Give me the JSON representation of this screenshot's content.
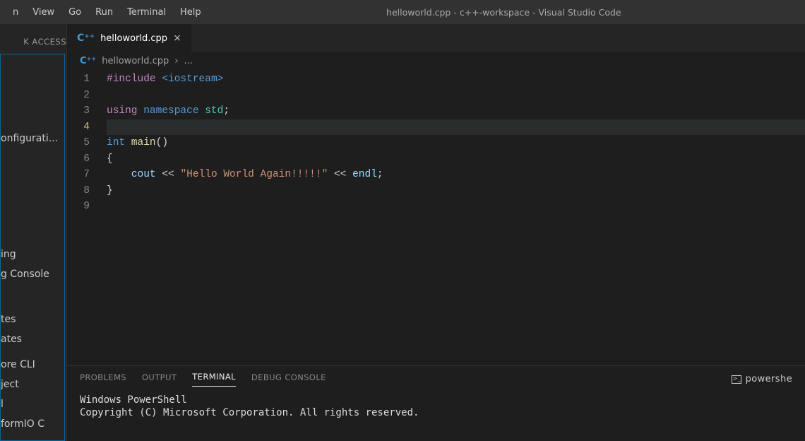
{
  "menu": [
    "n",
    "View",
    "Go",
    "Run",
    "Terminal",
    "Help"
  ],
  "windowTitle": "helloworld.cpp - c++-workspace - Visual Studio Code",
  "sidebar": {
    "heading": "K ACCESS",
    "configItem": "onfigurati...",
    "itemsMid": [
      "ing",
      "g Console"
    ],
    "itemsLow1": [
      "tes",
      "ates"
    ],
    "itemsLow2": [
      "ore CLI",
      "ject",
      "l",
      "formIO C"
    ]
  },
  "tab": {
    "file": "helloworld.cpp"
  },
  "breadcrumb": {
    "file": "helloworld.cpp",
    "sep": "›",
    "ell": "..."
  },
  "code": {
    "lines": [
      1,
      2,
      3,
      4,
      5,
      6,
      7,
      8,
      9
    ],
    "current": 4,
    "l1": {
      "inc": "#include",
      "hdr": " <iostream>"
    },
    "l3": {
      "using": "using",
      "ns": " namespace",
      "std": " std",
      "semi": ";"
    },
    "l5": {
      "int": "int",
      "main": " main",
      "par": "()"
    },
    "l6": "{",
    "l7": {
      "indent": "    ",
      "cout": "cout",
      "op1": " << ",
      "str": "\"Hello World Again!!!!!\"",
      "op2": " << ",
      "endl": "endl",
      "semi": ";"
    },
    "l8": "}"
  },
  "panel": {
    "tabs": [
      "PROBLEMS",
      "OUTPUT",
      "TERMINAL",
      "DEBUG CONSOLE"
    ],
    "active": 2,
    "shellLabel": "powershe",
    "line1": "Windows PowerShell",
    "line2": "Copyright (C) Microsoft Corporation. All rights reserved."
  }
}
